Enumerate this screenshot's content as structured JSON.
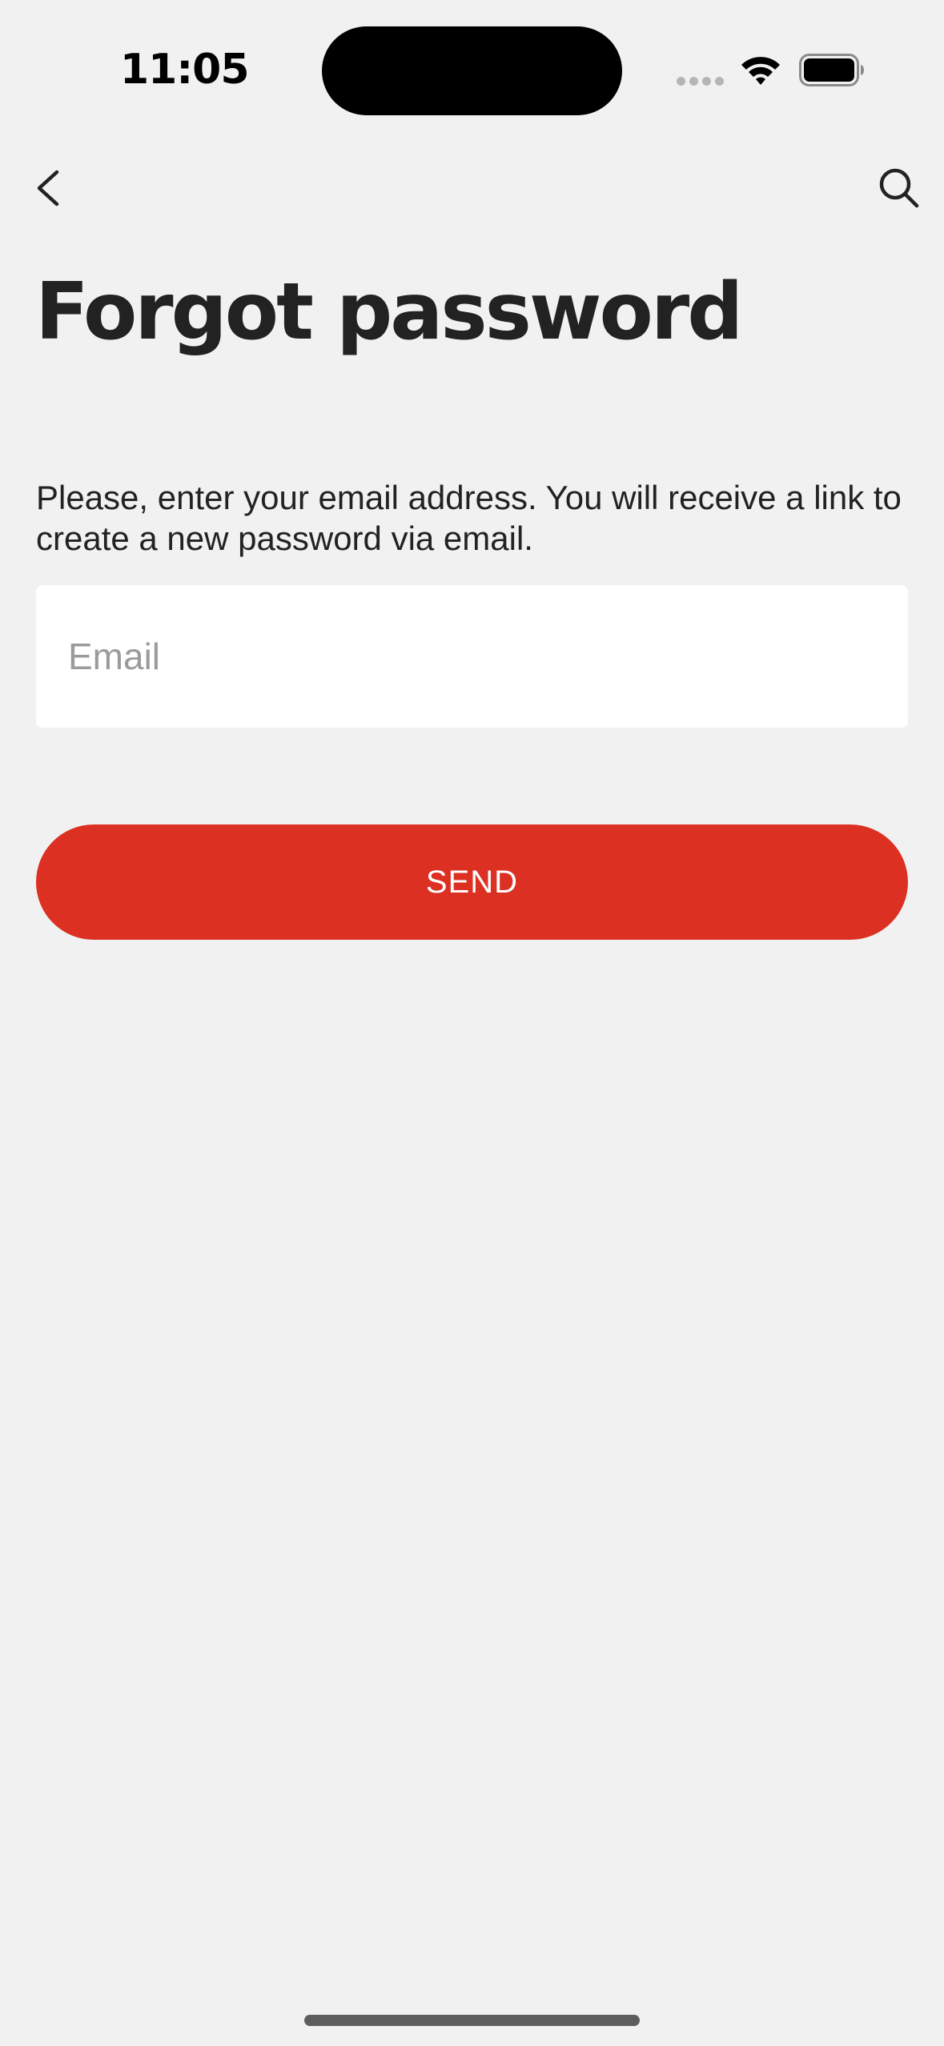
{
  "status_bar": {
    "time": "11:05"
  },
  "nav": {
    "back_icon": "chevron-left-icon",
    "search_icon": "search-icon"
  },
  "page": {
    "title": "Forgot password",
    "instructions": "Please, enter your email address. You will receive a link to create a new password via email."
  },
  "form": {
    "email_value": "",
    "email_placeholder": "Email",
    "send_label": "SEND"
  },
  "colors": {
    "background": "#f1f1f1",
    "accent": "#db3022",
    "text": "#222222",
    "placeholder": "#9b9b9b"
  }
}
